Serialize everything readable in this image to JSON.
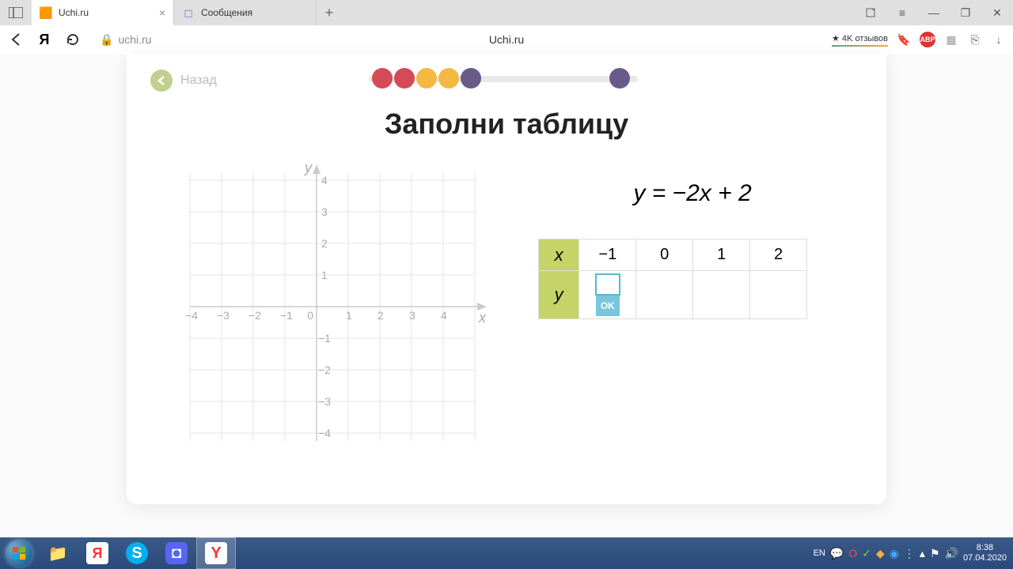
{
  "browser": {
    "tabs": [
      {
        "title": "Uchi.ru",
        "active": true
      },
      {
        "title": "Сообщения",
        "active": false
      }
    ],
    "url": "uchi.ru",
    "page_title": "Uchi.ru",
    "reviews": "★ 4K отзывов"
  },
  "lesson": {
    "back_label": "Назад",
    "title": "Заполни таблицу",
    "equation": "y = −2x + 2",
    "table": {
      "x_label": "x",
      "y_label": "y",
      "x_values": [
        "−1",
        "0",
        "1",
        "2"
      ],
      "y_values": [
        "",
        "",
        "",
        ""
      ],
      "ok_label": "OK"
    },
    "progress": {
      "dots": [
        "red",
        "red",
        "amber",
        "amber",
        "purple"
      ],
      "far_dot": "purple"
    }
  },
  "chart_data": {
    "type": "scatter",
    "title": "",
    "xlabel": "x",
    "ylabel": "y",
    "xlim": [
      -4,
      4
    ],
    "ylim": [
      -4,
      4
    ],
    "x_ticks": [
      -4,
      -3,
      -2,
      -1,
      0,
      1,
      2,
      3,
      4
    ],
    "y_ticks": [
      -4,
      -3,
      -2,
      -1,
      1,
      2,
      3,
      4
    ],
    "series": []
  },
  "taskbar": {
    "lang": "EN",
    "time": "8:38",
    "date": "07.04.2020"
  }
}
